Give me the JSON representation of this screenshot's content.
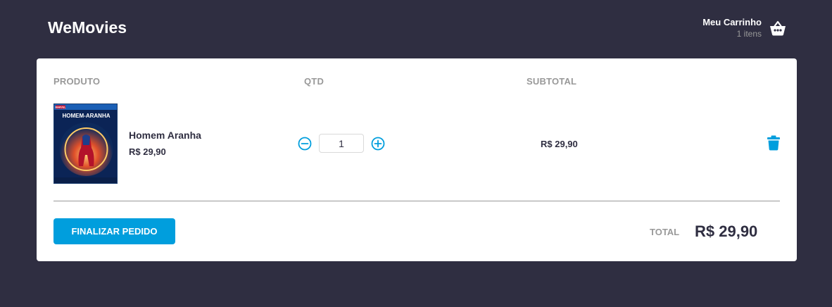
{
  "header": {
    "logo": "WeMovies",
    "cart_title": "Meu Carrinho",
    "cart_count": "1 itens",
    "cart_icon": "basket-icon"
  },
  "table": {
    "headers": [
      "PRODUTO",
      "QTD",
      "SUBTOTAL"
    ]
  },
  "item": {
    "title": "Homem Aranha",
    "price": "R$ 29,90",
    "quantity": "1",
    "subtotal": "R$ 29,90",
    "poster_title": "HOMEM-ARANHA",
    "poster_brand": "MARVEL"
  },
  "footer": {
    "checkout_label": "FINALIZAR PEDIDO",
    "total_label": "TOTAL",
    "total_value": "R$ 29,90"
  },
  "colors": {
    "background": "#2f2e41",
    "accent": "#009edd",
    "muted": "#999999"
  }
}
